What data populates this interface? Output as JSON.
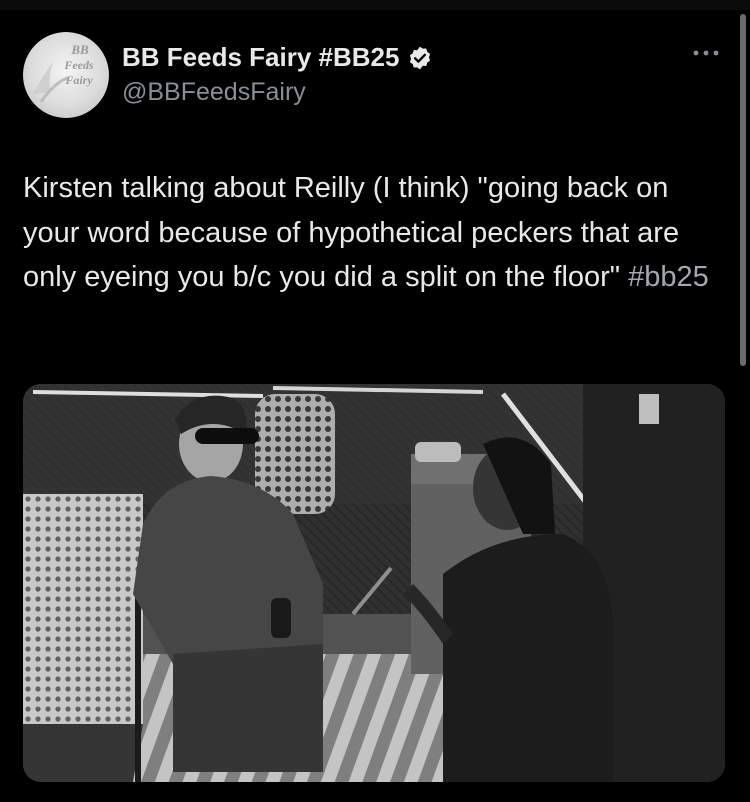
{
  "tweet": {
    "display_name": "BB Feeds Fairy #BB25",
    "handle": "@BBFeedsFairy",
    "verified_icon": "verified-badge-icon",
    "more_icon": "more-options-icon",
    "body_text": "Kirsten talking about Reilly (I think) \"going back on your word because of hypothetical peckers that are only eyeing you b/c you did a split on the floor\"",
    "hashtag": "#bb25",
    "avatar_logo_text": "BB Feeds Fairy"
  },
  "colors": {
    "background": "#000000",
    "text_primary": "#e7e9ea",
    "text_secondary": "#8b8f94",
    "hashtag": "#a4a8ad"
  }
}
